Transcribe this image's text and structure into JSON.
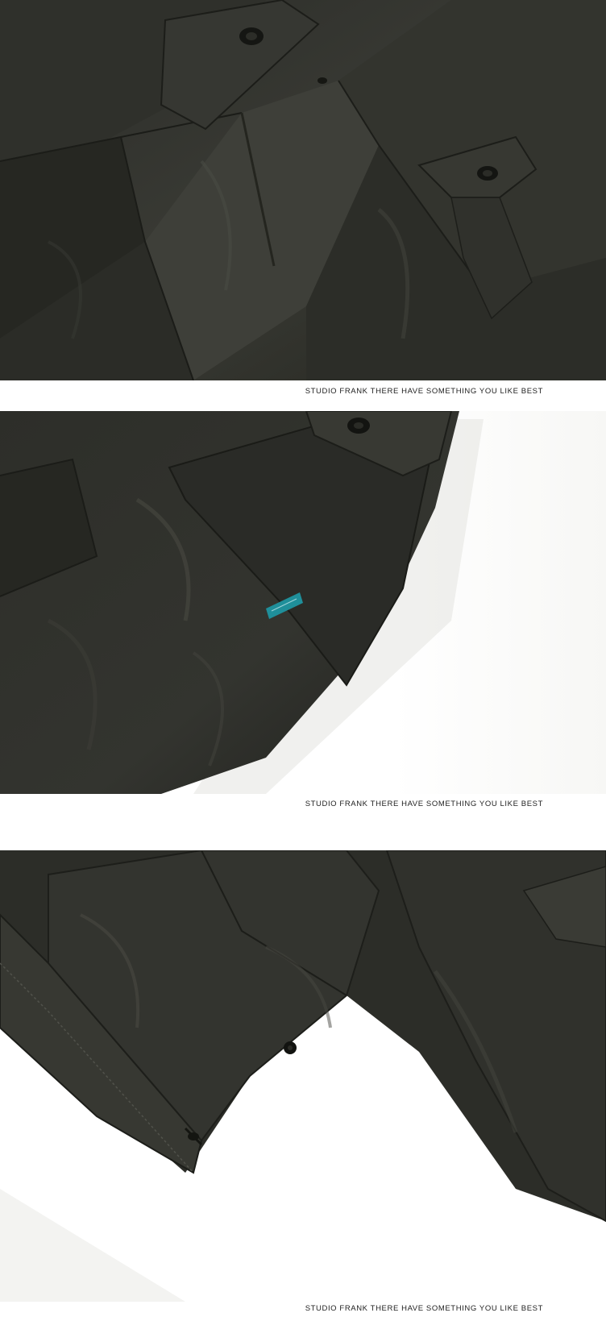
{
  "panels": [
    {
      "photo": "jacket-chest-pocket-detail",
      "caption": "STUDIO FRANK THERE HAVE SOMETHING YOU LIKE BEST"
    },
    {
      "photo": "jacket-side-pocket-label-detail",
      "caption": "STUDIO FRANK THERE HAVE SOMETHING YOU LIKE BEST"
    },
    {
      "photo": "jacket-hem-detail",
      "caption": "STUDIO FRANK THERE HAVE SOMETHING YOU LIKE BEST"
    }
  ],
  "colors": {
    "fabric_dark": "#1f201d",
    "fabric_mid": "#2e2f2b",
    "fabric_light": "#45463f",
    "label_teal": "#1f8f9a",
    "background": "#ffffff"
  }
}
